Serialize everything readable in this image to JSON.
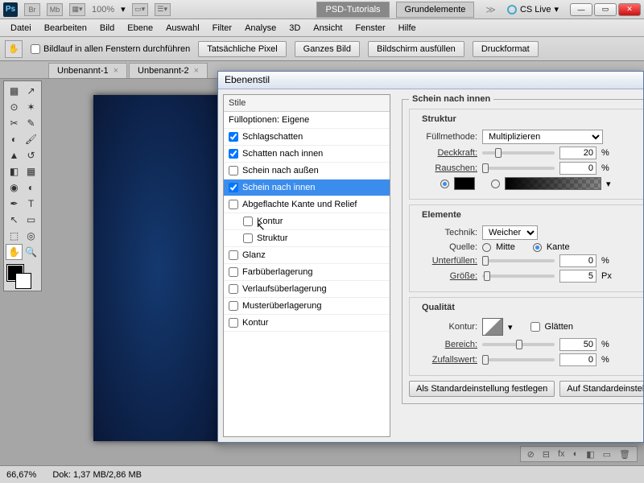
{
  "titlebar": {
    "app": "Ps",
    "mini1": "Br",
    "mini2": "Mb",
    "zoom": "100%",
    "tab_active": "PSD-Tutorials",
    "tab_inactive": "Grundelemente",
    "cslive": "CS Live"
  },
  "menu": [
    "Datei",
    "Bearbeiten",
    "Bild",
    "Ebene",
    "Auswahl",
    "Filter",
    "Analyse",
    "3D",
    "Ansicht",
    "Fenster",
    "Hilfe"
  ],
  "optbar": {
    "scroll_label": "Bildlauf in allen Fenstern durchführen",
    "btn1": "Tatsächliche Pixel",
    "btn2": "Ganzes Bild",
    "btn3": "Bildschirm ausfüllen",
    "btn4": "Druckformat"
  },
  "doctabs": [
    {
      "name": "Unbenannt-1",
      "x": "×"
    },
    {
      "name": "Unbenannt-2",
      "x": "×"
    }
  ],
  "status": {
    "zoom": "66,67%",
    "doc": "Dok: 1,37 MB/2,86 MB"
  },
  "dialog": {
    "title": "Ebenenstil",
    "left_header": "Stile",
    "left_fill": "Fülloptionen: Eigene",
    "styles": {
      "schlagschatten": "Schlagschatten",
      "schatten_innen": "Schatten nach innen",
      "schein_aussen": "Schein nach außen",
      "schein_innen": "Schein nach innen",
      "abgeflachte": "Abgeflachte Kante und Relief",
      "kontur_sub": "Kontur",
      "struktur_sub": "Struktur",
      "glanz": "Glanz",
      "farb": "Farbüberlagerung",
      "verlauf": "Verlaufsüberlagerung",
      "muster": "Musterüberlagerung",
      "kontur": "Kontur"
    },
    "section_title": "Schein nach innen",
    "struktur": {
      "legend": "Struktur",
      "fuellmethode_lbl": "Füllmethode:",
      "fuellmethode_val": "Multiplizieren",
      "deckkraft_lbl": "Deckkraft:",
      "deckkraft_val": "20",
      "rauschen_lbl": "Rauschen:",
      "rauschen_val": "0",
      "pct": "%"
    },
    "elemente": {
      "legend": "Elemente",
      "technik_lbl": "Technik:",
      "technik_val": "Weicher",
      "quelle_lbl": "Quelle:",
      "mitte": "Mitte",
      "kante": "Kante",
      "unterfuellen_lbl": "Unterfüllen:",
      "unterfuellen_val": "0",
      "groesse_lbl": "Größe:",
      "groesse_val": "5",
      "pct": "%",
      "px": "Px"
    },
    "qualitaet": {
      "legend": "Qualität",
      "kontur_lbl": "Kontur:",
      "glaetten": "Glätten",
      "bereich_lbl": "Bereich:",
      "bereich_val": "50",
      "zufall_lbl": "Zufallswert:",
      "zufall_val": "0",
      "pct": "%"
    },
    "btn_default": "Als Standardeinstellung festlegen",
    "btn_reset": "Auf Standardeinstellung zurück"
  }
}
